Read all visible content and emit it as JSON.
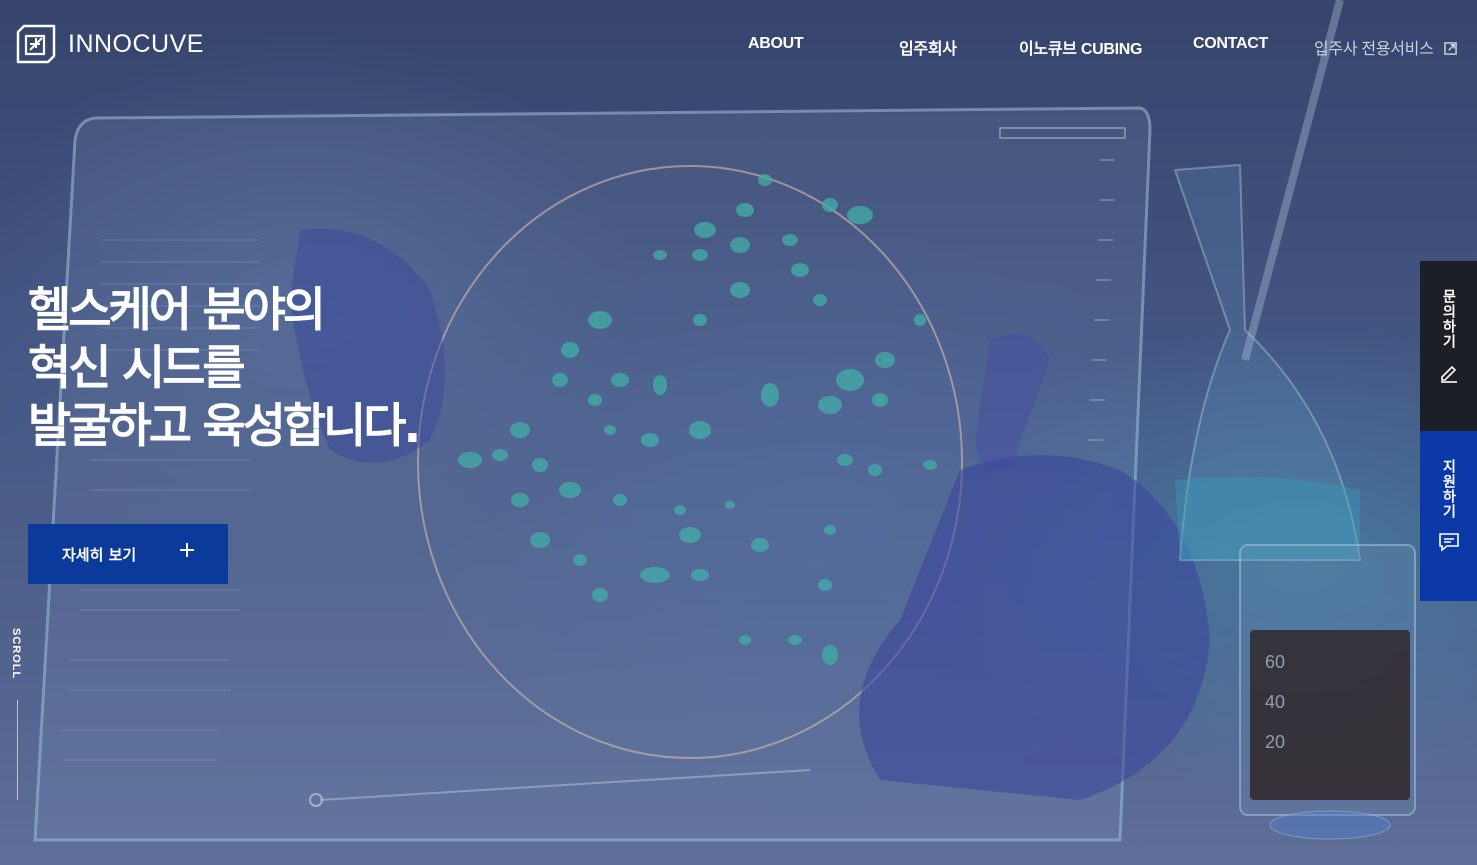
{
  "brand": {
    "name": "INNOCUVE"
  },
  "nav": {
    "items": [
      {
        "label": "ABOUT"
      },
      {
        "label": "입주회사"
      },
      {
        "label": "이노큐브 CUBING"
      },
      {
        "label": "CONTACT"
      }
    ],
    "external": {
      "label": "입주사 전용서비스",
      "icon": "external-link-icon"
    }
  },
  "hero": {
    "headline": [
      "헬스케어 분야의",
      "혁신 시드를",
      "발굴하고 육성합니다."
    ],
    "cta_label": "자세히 보기",
    "cta_icon": "plus-icon",
    "scroll_label": "SCROLL"
  },
  "side": {
    "inquiry": {
      "label": "문의하기",
      "icon": "pencil-icon"
    },
    "apply": {
      "label": "지원하기",
      "icon": "chat-icon"
    }
  },
  "colors": {
    "cta": "#0b3a9a",
    "apply_tab": "#0b3aa8",
    "inquiry_tab": "#1c1f26",
    "overlay": "#3e4f78",
    "cell_spots": "#48c9b7"
  }
}
